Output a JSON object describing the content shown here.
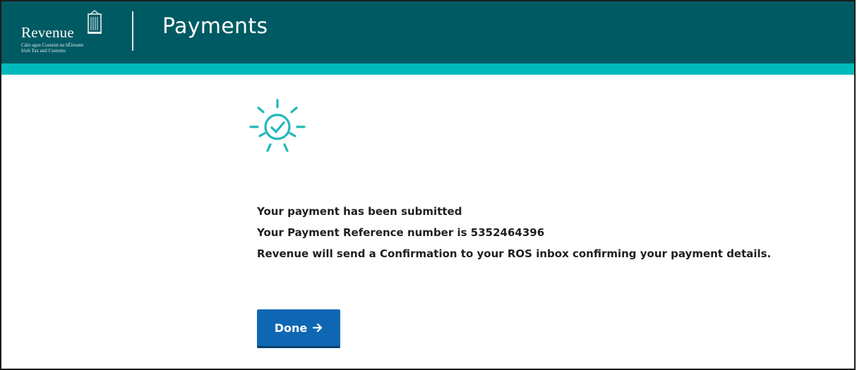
{
  "header": {
    "logo_word": "Revenue",
    "logo_sub_line1": "Cáin agus Custaim na hÉireann",
    "logo_sub_line2": "Irish Tax and Customs",
    "title": "Payments"
  },
  "main": {
    "icon": "success-sun-check-icon",
    "line1": "Your payment has been submitted",
    "line2": "Your Payment Reference number is 5352464396",
    "line3": "Revenue will send a Confirmation to your ROS inbox confirming your payment details."
  },
  "actions": {
    "done_label": "Done",
    "done_icon": "arrow-right-icon"
  },
  "colors": {
    "header": "#005a63",
    "accent": "#00b9bb",
    "icon": "#20b7b9",
    "button": "#0f67b4"
  }
}
